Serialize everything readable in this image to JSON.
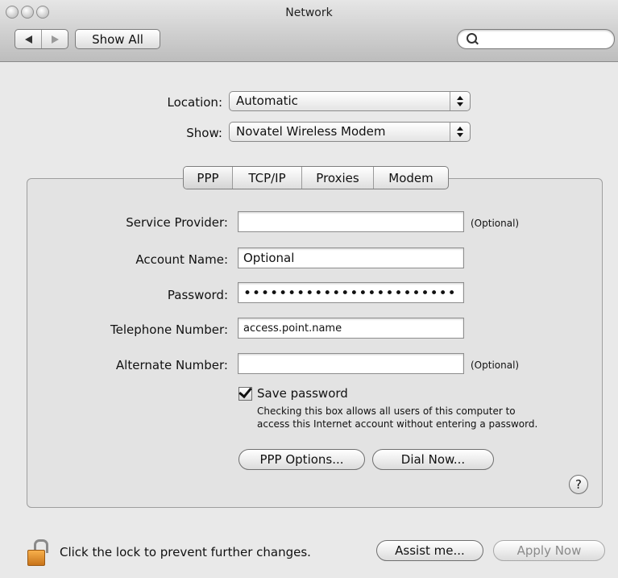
{
  "window": {
    "title": "Network"
  },
  "toolbar": {
    "show_all_label": "Show All",
    "search_placeholder": ""
  },
  "location": {
    "label": "Location:",
    "value": "Automatic"
  },
  "show": {
    "label": "Show:",
    "value": "Novatel Wireless Modem"
  },
  "tabs": [
    {
      "label": "PPP",
      "selected": true
    },
    {
      "label": "TCP/IP",
      "selected": false
    },
    {
      "label": "Proxies",
      "selected": false
    },
    {
      "label": "Modem",
      "selected": false
    }
  ],
  "form": {
    "service_provider": {
      "label": "Service Provider:",
      "value": "",
      "note": "(Optional)"
    },
    "account_name": {
      "label": "Account Name:",
      "value": "Optional"
    },
    "password": {
      "label": "Password:",
      "value": "••••••••••••••••••••••••"
    },
    "telephone": {
      "label": "Telephone Number:",
      "value": "access.point.name"
    },
    "alternate": {
      "label": "Alternate Number:",
      "value": "",
      "note": "(Optional)"
    }
  },
  "save_password": {
    "label": "Save password",
    "checked": true,
    "hint_line1": "Checking this box allows all users of this computer to",
    "hint_line2": "access this Internet account without entering a password."
  },
  "buttons": {
    "ppp_options": "PPP Options...",
    "dial_now": "Dial Now...",
    "help": "?",
    "assist_me": "Assist me...",
    "apply_now": "Apply Now"
  },
  "footer": {
    "lock_text": "Click the lock to prevent further changes."
  }
}
